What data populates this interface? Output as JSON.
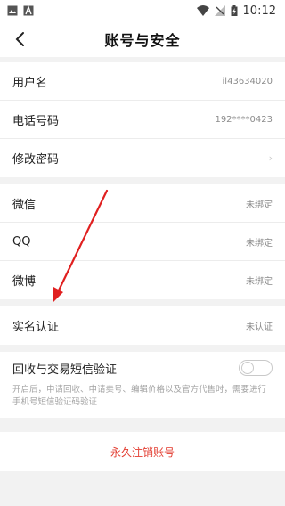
{
  "status_bar": {
    "time": "10:12",
    "icons": [
      "image-icon",
      "font-icon",
      "wifi-icon",
      "signal-icon",
      "battery-icon"
    ]
  },
  "header": {
    "title": "账号与安全",
    "back_icon": "back-chevron-icon"
  },
  "account_section": [
    {
      "label": "用户名",
      "value": "il43634020"
    },
    {
      "label": "电话号码",
      "value": "192****0423"
    },
    {
      "label": "修改密码",
      "value": ""
    }
  ],
  "binding_section": [
    {
      "label": "微信",
      "value": "未绑定"
    },
    {
      "label": "QQ",
      "value": "未绑定"
    },
    {
      "label": "微博",
      "value": "未绑定"
    }
  ],
  "verify_section": [
    {
      "label": "实名认证",
      "value": "未认证"
    }
  ],
  "sms_verify": {
    "label": "回收与交易短信验证",
    "enabled": false,
    "description": "开启后，申请回收、申请卖号、编辑价格以及官方代售时，需要进行手机号短信验证码验证"
  },
  "delete_account": {
    "label": "永久注销账号",
    "color": "#e23a2e"
  },
  "annotation": {
    "arrow_color": "#e02020"
  }
}
